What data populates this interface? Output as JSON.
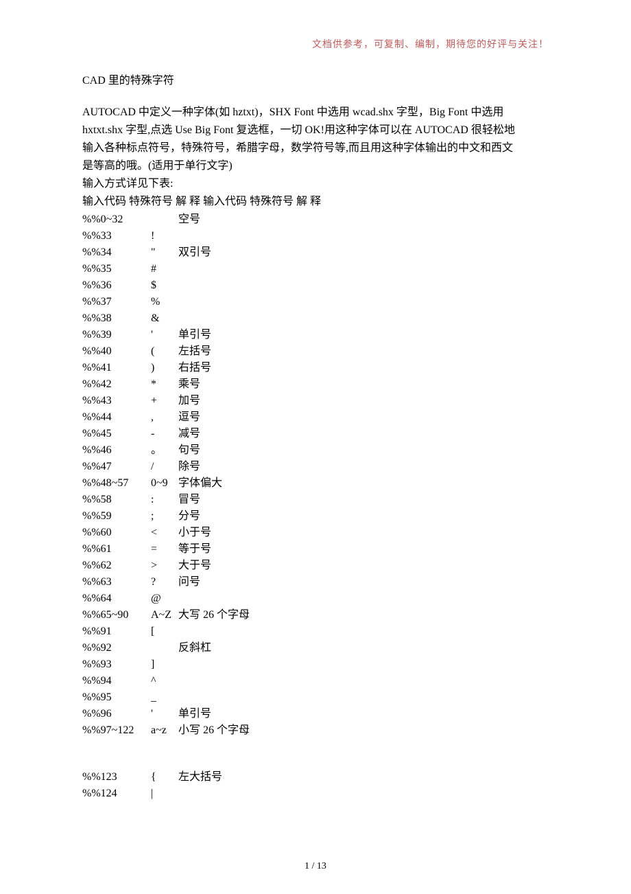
{
  "header_note": "文档供参考，可复制、编制，期待您的好评与关注！",
  "title": "CAD 里的特殊字符",
  "intro": [
    "AUTOCAD 中定义一种字体(如 hztxt)，SHX Font 中选用 wcad.shx 字型，Big Font 中选用",
    "hxtxt.shx 字型,点选 Use Big Font 复选框，一切 OK!用这种字体可以在 AUTOCAD 很轻松地",
    "输入各种标点符号，特殊符号，希腊字母，数学符号等,而且用这种字体输出的中文和西文",
    "是等高的哦。(适用于单行文字)",
    "输入方式详见下表:",
    "输入代码  特殊符号  解  释  输入代码  特殊符号  解  释"
  ],
  "entries_block1": [
    {
      "code": "%%0~32",
      "sym": "",
      "desc": "空号"
    },
    {
      "code": "%%33",
      "sym": "!",
      "desc": ""
    },
    {
      "code": "%%34",
      "sym": "\"",
      "desc": "双引号"
    },
    {
      "code": "%%35",
      "sym": "#",
      "desc": ""
    },
    {
      "code": "%%36",
      "sym": "$",
      "desc": ""
    },
    {
      "code": "%%37",
      "sym": "%",
      "desc": ""
    },
    {
      "code": "%%38",
      "sym": "&",
      "desc": ""
    },
    {
      "code": "%%39",
      "sym": "'",
      "desc": "单引号"
    },
    {
      "code": "%%40",
      "sym": "(",
      "desc": "左括号"
    },
    {
      "code": "%%41",
      "sym": ")",
      "desc": "右括号"
    },
    {
      "code": "%%42",
      "sym": "*",
      "desc": "乘号"
    },
    {
      "code": "%%43",
      "sym": "+",
      "desc": "加号"
    },
    {
      "code": "%%44",
      "sym": ",",
      "desc": "逗号"
    },
    {
      "code": "%%45",
      "sym": "-",
      "desc": "减号"
    },
    {
      "code": "%%46",
      "sym": "。",
      "desc": "句号"
    },
    {
      "code": "%%47",
      "sym": "/",
      "desc": "除号"
    },
    {
      "code": "%%48~57",
      "sym": "0~9",
      "desc": "字体偏大"
    },
    {
      "code": "%%58",
      "sym": ":",
      "desc": "冒号"
    },
    {
      "code": "%%59",
      "sym": ";",
      "desc": "分号"
    },
    {
      "code": "%%60",
      "sym": "<",
      "desc": "小于号"
    },
    {
      "code": "%%61",
      "sym": "=",
      "desc": "等于号"
    },
    {
      "code": "%%62",
      "sym": ">",
      "desc": "大于号"
    },
    {
      "code": "%%63",
      "sym": "?",
      "desc": "问号"
    },
    {
      "code": "%%64",
      "sym": "@",
      "desc": ""
    },
    {
      "code": "%%65~90",
      "sym": "A~Z",
      "desc": "大写 26 个字母"
    },
    {
      "code": "%%91",
      "sym": "[",
      "desc": ""
    },
    {
      "code": "%%92",
      "sym": "",
      "desc": "反斜杠"
    },
    {
      "code": "%%93",
      "sym": "]",
      "desc": ""
    },
    {
      "code": "%%94",
      "sym": "^",
      "desc": ""
    },
    {
      "code": "%%95",
      "sym": "_",
      "desc": ""
    },
    {
      "code": "%%96",
      "sym": "'",
      "desc": "单引号"
    },
    {
      "code": "%%97~122",
      "sym": "a~z",
      "desc": "小写 26 个字母"
    }
  ],
  "entries_block2": [
    {
      "code": "%%123",
      "sym": "{",
      "desc": "左大括号"
    },
    {
      "code": "%%124",
      "sym": "|",
      "desc": ""
    }
  ],
  "page_number": "1  /  13"
}
